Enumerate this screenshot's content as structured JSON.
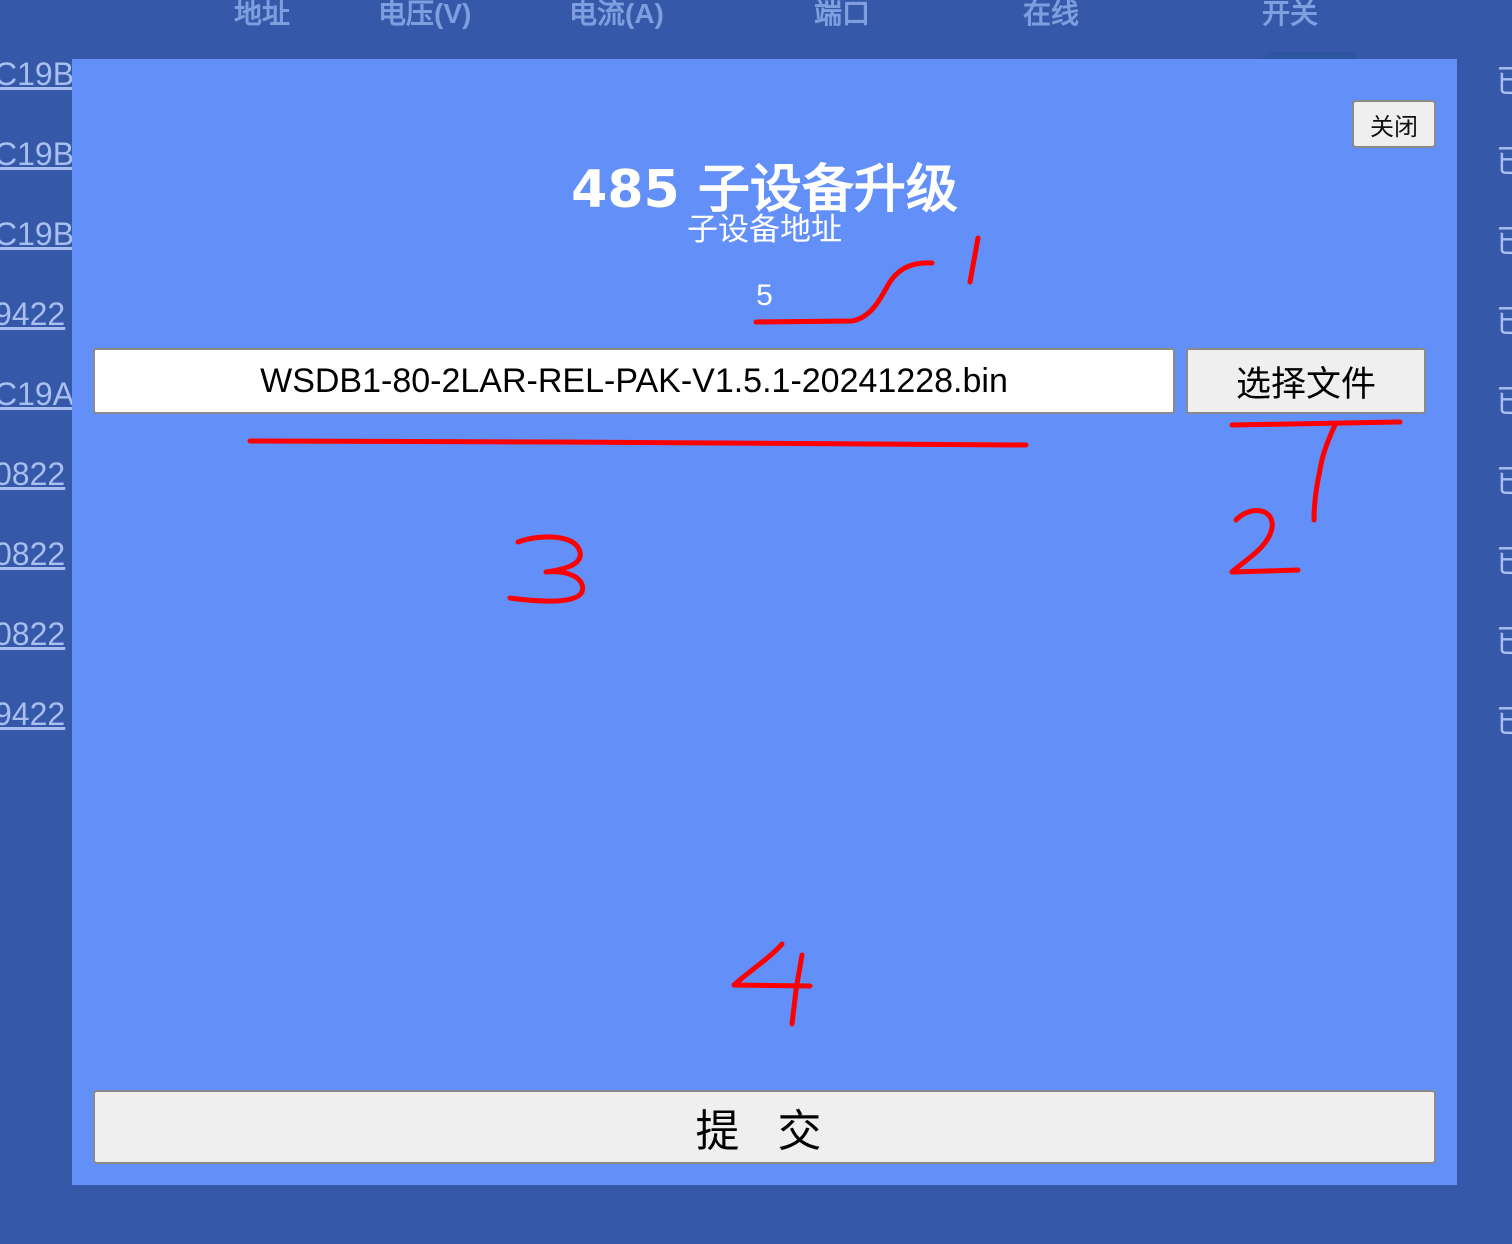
{
  "background": {
    "table_headers": [
      "地址",
      "电压(V)",
      "电流(A)",
      "端口",
      "在线",
      "开关"
    ],
    "left_column": [
      "C19B",
      "C19B",
      "C19B",
      "9422",
      "C19A",
      "0822",
      "0822",
      "0822",
      "9422"
    ],
    "right_column": [
      "已",
      "已",
      "已",
      "已",
      "已",
      "已",
      "已",
      "已",
      "已"
    ]
  },
  "modal": {
    "title": "485 子设备升级",
    "close_label": "关闭",
    "address_label": "子设备地址",
    "address_value": "5",
    "file_name": "WSDB1-80-2LAR-REL-PAK-V1.5.1-20241228.bin",
    "choose_file_label": "选择文件",
    "submit_label": "提 交"
  },
  "annotations": {
    "color": "#ff0000",
    "markers": [
      "1",
      "2",
      "3",
      "4"
    ]
  },
  "colors": {
    "page_background": "#3559a8",
    "modal_background": "#638ff8",
    "button_background": "#efefef"
  }
}
